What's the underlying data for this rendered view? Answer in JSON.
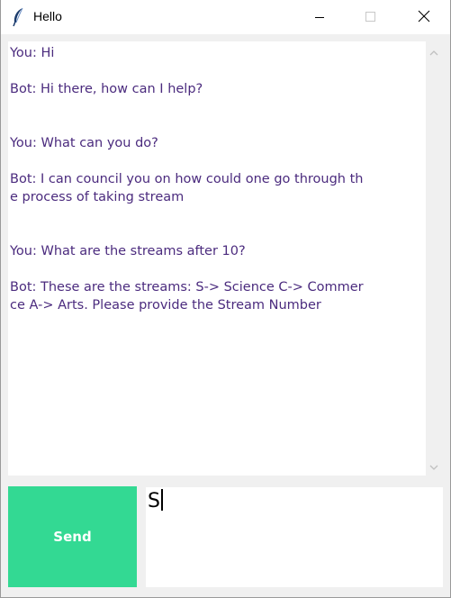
{
  "window": {
    "title": "Hello",
    "controls": {
      "minimize": "minimize-icon",
      "maximize": "maximize-icon",
      "close": "close-icon"
    }
  },
  "chat": {
    "lines": [
      "You: Hi",
      "",
      "Bot: Hi there, how can I help?",
      "",
      "",
      "You: What can you do?",
      "",
      "Bot: I can council you on how could one go through th",
      "e process of taking stream",
      "",
      "",
      "You: What are the streams after 10?",
      "",
      "Bot: These are the streams: S-> Science C-> Commer",
      "ce A-> Arts. Please provide the Stream Number"
    ]
  },
  "send_button": {
    "label": "Send"
  },
  "entry": {
    "value": "S"
  },
  "colors": {
    "chat_text": "#4b2b7e",
    "send_button_bg": "#33d993",
    "send_button_text": "#ffffff",
    "window_bg": "#f0f0f0"
  }
}
